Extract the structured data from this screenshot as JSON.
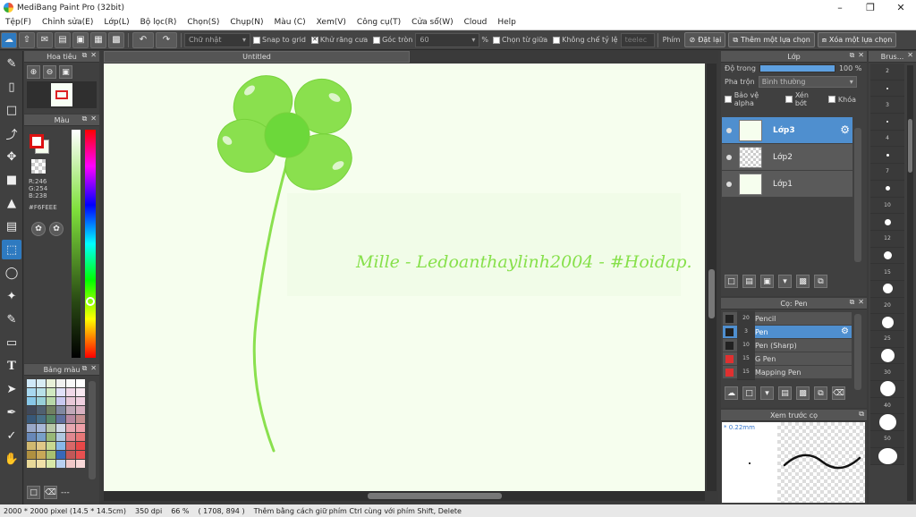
{
  "window": {
    "title": "MediBang Paint Pro (32bit)"
  },
  "menu": [
    "Tệp(F)",
    "Chỉnh sửa(E)",
    "Lớp(L)",
    "Bộ lọc(R)",
    "Chọn(S)",
    "Chụp(N)",
    "Màu (C)",
    "Xem(V)",
    "Công cụ(T)",
    "Cửa sổ(W)",
    "Cloud",
    "Help"
  ],
  "toolbar": {
    "shape_select": "Chữ nhật",
    "snap_to_grid": "Snap to grid",
    "antialias": "Khử răng cưa",
    "round_corner": "Góc tròn",
    "round_value": "60",
    "percent": "%",
    "select_center": "Chọn từ giữa",
    "no_ratio": "Không chế tỷ lệ",
    "ratio_field": "teelec",
    "key_label": "Phím",
    "reset": "Đặt lại",
    "add_selection": "Thêm một lựa chọn",
    "remove_selection": "Xóa một lựa chọn"
  },
  "navigator": {
    "title": "Hoa tiêu"
  },
  "color": {
    "title": "Màu",
    "r": "R:246",
    "g": "G:254",
    "b": "B:238",
    "hex": "#F6FEEE",
    "foreground": "#ff0000",
    "background": "#f6feee"
  },
  "palette": {
    "title": "Bảng màu",
    "footer": "---",
    "colors": [
      "#cfe8f8",
      "#d8ecf4",
      "#e8f0d8",
      "#f0f0f0",
      "#f8f8f8",
      "#ffffff",
      "#a8d8f0",
      "#b8e0e8",
      "#d0e8c0",
      "#e0e0f8",
      "#f0d8e8",
      "#f8e8f0",
      "#88c8e8",
      "#98d0d8",
      "#b8d8a8",
      "#c8c8f0",
      "#e8c8d8",
      "#f0d0e0",
      "#404858",
      "#506070",
      "#708060",
      "#8088a0",
      "#c0a8b8",
      "#d8b0c0",
      "#385878",
      "#487088",
      "#588868",
      "#6070a0",
      "#b888a0",
      "#c89090",
      "#98a8c8",
      "#a8b8d8",
      "#b8c8a8",
      "#d0d8e8",
      "#e8a8b0",
      "#f0a0a8",
      "#6888b8",
      "#78a0c8",
      "#98b878",
      "#b0c8e0",
      "#e08890",
      "#e87878",
      "#d0b870",
      "#e0c888",
      "#c8d890",
      "#88b8e8",
      "#d86868",
      "#e84848",
      "#b09040",
      "#c8a858",
      "#a8c070",
      "#3868b8",
      "#c05858",
      "#e85050",
      "#e8d898",
      "#f0e0a8",
      "#d8e8a8",
      "#b8d0f0",
      "#f0c8c8",
      "#f8d8d8"
    ]
  },
  "canvas": {
    "tab": "Untitled",
    "signature": "Mille - Ledoanthaylinh2004 - #Hoidap."
  },
  "layer_panel": {
    "title": "Lớp",
    "opacity_label": "Độ trong",
    "opacity_value": "100 %",
    "blend_label": "Pha trộn",
    "blend_value": "Bình thường",
    "protect_alpha": "Bảo vệ alpha",
    "clipping": "Xén bớt",
    "lock": "Khóa",
    "layers": [
      "Lớp3",
      "Lớp2",
      "Lớp1"
    ]
  },
  "brush_panel": {
    "title": "Cọ: Pen",
    "brushes": [
      {
        "size": "20",
        "name": "Pencil",
        "color": "#222222"
      },
      {
        "size": "3",
        "name": "Pen",
        "color": "#222222"
      },
      {
        "size": "10",
        "name": "Pen (Sharp)",
        "color": "#222222"
      },
      {
        "size": "15",
        "name": "G Pen",
        "color": "#e03030"
      },
      {
        "size": "15",
        "name": "Mapping Pen",
        "color": "#e03030"
      }
    ]
  },
  "preview": {
    "title": "Xem trước cọ",
    "size": "* 0.22mm"
  },
  "size_panel": {
    "title": "Brus...",
    "sizes": [
      "2",
      "",
      "3",
      "",
      "4",
      "",
      "7",
      "",
      "10",
      "",
      "12",
      "",
      "15",
      "",
      "20",
      "",
      "25",
      "",
      "30",
      "",
      "40",
      "",
      "50",
      ""
    ]
  },
  "status": {
    "pixels": "2000 * 2000 pixel",
    "cm": "(14.5 * 14.5cm)",
    "dpi": "350 dpi",
    "zoom": "66 %",
    "coords": "( 1708, 894 )",
    "hint": "Thêm bằng cách giữ phím Ctrl cùng với phím Shift, Delete"
  }
}
